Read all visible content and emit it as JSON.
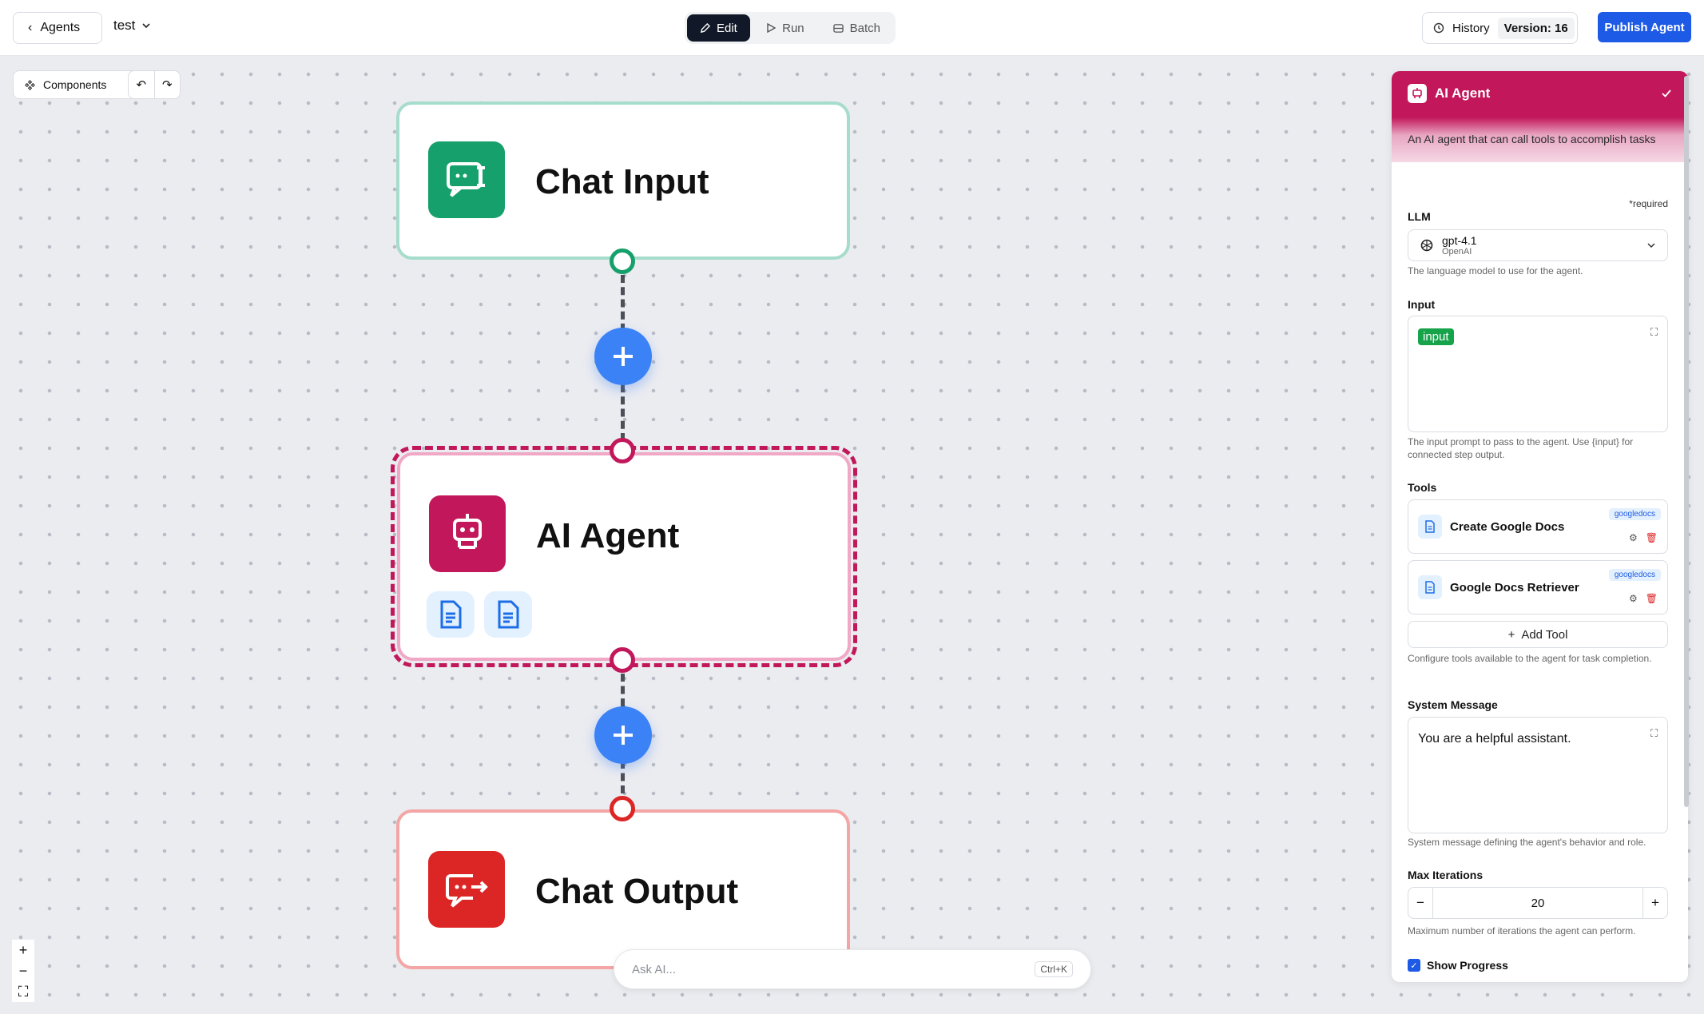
{
  "topbar": {
    "back_label": "Agents",
    "agent_name": "test",
    "modes": [
      {
        "label": "Edit",
        "active": true
      },
      {
        "label": "Run",
        "active": false
      },
      {
        "label": "Batch",
        "active": false
      }
    ],
    "history_label": "History",
    "version_label": "Version: 16",
    "publish_label": "Publish Agent"
  },
  "canvas": {
    "components_label": "Components",
    "nodes": {
      "chat_input": {
        "title": "Chat Input",
        "color": "#16a06b"
      },
      "ai_agent": {
        "title": "AI Agent",
        "color": "#c2185b"
      },
      "chat_output": {
        "title": "Chat Output",
        "color": "#dc2626"
      }
    },
    "ask_ai_placeholder": "Ask AI...",
    "ask_ai_shortcut": "Ctrl+K"
  },
  "panel": {
    "title": "AI Agent",
    "description": "An AI agent that can call tools to accomplish tasks",
    "required_note": "*required",
    "llm": {
      "label": "LLM",
      "model": "gpt-4.1",
      "provider": "OpenAI",
      "hint": "The language model to use for the agent."
    },
    "input": {
      "label": "Input",
      "chip": "input",
      "hint": "The input prompt to pass to the agent. Use {input} for connected step output."
    },
    "tools": {
      "label": "Tools",
      "items": [
        {
          "name": "Create Google Docs",
          "tag": "googledocs"
        },
        {
          "name": "Google Docs Retriever",
          "tag": "googledocs"
        }
      ],
      "add_label": "Add Tool",
      "hint": "Configure tools available to the agent for task completion."
    },
    "system_message": {
      "label": "System Message",
      "value": "You are a helpful assistant.",
      "hint": "System message defining the agent's behavior and role."
    },
    "max_iterations": {
      "label": "Max Iterations",
      "value": "20",
      "hint": "Maximum number of iterations the agent can perform."
    },
    "show_progress": {
      "label": "Show Progress",
      "checked": true
    }
  }
}
